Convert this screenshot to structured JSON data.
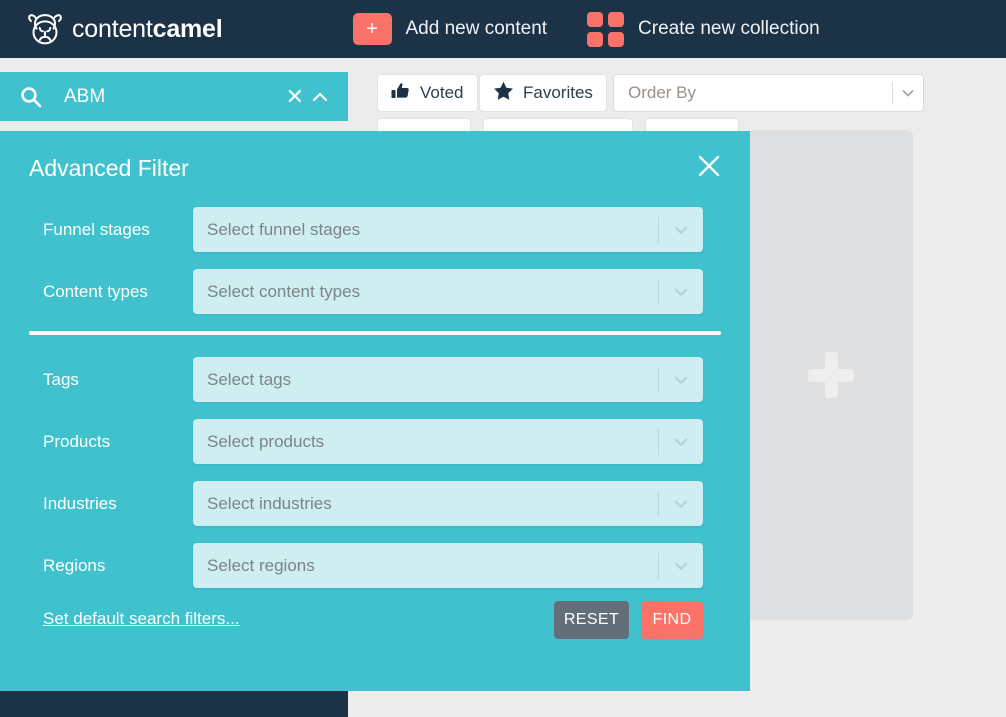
{
  "topnav": {
    "logo": {
      "icon": "camel-logo-icon",
      "text_light": "content",
      "text_bold": "camel"
    },
    "actions": [
      {
        "icon": "plus-icon",
        "glyph": "+",
        "label": "Add new content"
      },
      {
        "icon": "grid-squares-icon",
        "label": "Create new collection"
      }
    ],
    "colors": {
      "background": "#1c3347",
      "accent": "#fa7268"
    }
  },
  "search": {
    "icon": "search-icon",
    "value": "ABM",
    "clear_icon": "close-icon",
    "collapse_icon": "chevron-up-icon",
    "background": "#3fc1ce"
  },
  "toolbar": {
    "voted": {
      "icon": "thumbs-up-icon",
      "label": "Voted"
    },
    "favorites": {
      "icon": "star-icon",
      "label": "Favorites"
    },
    "order_by": {
      "placeholder": "Order By",
      "value": "",
      "chevron": "chevron-down-icon"
    }
  },
  "content_area": {
    "add_card": {
      "icon": "plus-icon",
      "label": ""
    }
  },
  "advanced_filter": {
    "title": "Advanced Filter",
    "close_icon": "close-icon",
    "background": "#3fc1ce",
    "field_background": "#cfeef1",
    "group_primary": [
      {
        "label": "Funnel stages",
        "placeholder": "Select funnel stages",
        "value": "",
        "chevron": "chevron-down-icon"
      },
      {
        "label": "Content types",
        "placeholder": "Select content types",
        "value": "",
        "chevron": "chevron-down-icon"
      }
    ],
    "group_secondary": [
      {
        "label": "Tags",
        "placeholder": "Select tags",
        "value": "",
        "chevron": "chevron-down-icon"
      },
      {
        "label": "Products",
        "placeholder": "Select products",
        "value": "",
        "chevron": "chevron-down-icon"
      },
      {
        "label": "Industries",
        "placeholder": "Select industries",
        "value": "",
        "chevron": "chevron-down-icon"
      },
      {
        "label": "Regions",
        "placeholder": "Select regions",
        "value": "",
        "chevron": "chevron-down-icon"
      }
    ],
    "footer": {
      "default_filters_link": "Set default search filters...",
      "reset_label": "RESET",
      "find_label": "FIND",
      "reset_color": "#646e78",
      "find_color": "#fa7268"
    }
  }
}
